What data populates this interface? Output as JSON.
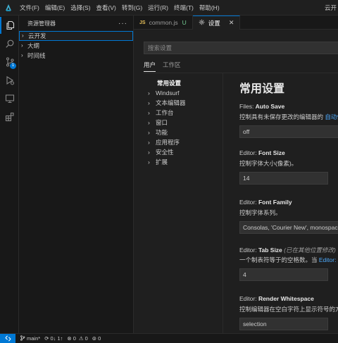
{
  "menubar": {
    "items": [
      "文件(F)",
      "编辑(E)",
      "选择(S)",
      "查看(V)",
      "转到(G)",
      "运行(R)",
      "终端(T)",
      "帮助(H)"
    ],
    "title_fragment": "云开"
  },
  "activitybar": {
    "icons": [
      "explorer-icon",
      "search-icon",
      "source-control-icon",
      "run-debug-icon",
      "remote-explorer-icon",
      "extensions-icon"
    ],
    "scm_badge": "1"
  },
  "explorer": {
    "title": "资源管理器",
    "more": "···",
    "items": [
      {
        "label": "云开发"
      },
      {
        "label": "大纲"
      },
      {
        "label": "时间线"
      }
    ]
  },
  "tabs": [
    {
      "icon": "JS",
      "label": "common.js",
      "status": "U"
    },
    {
      "icon": "gear-icon",
      "label": "设置",
      "close": "✕"
    }
  ],
  "settings": {
    "search_placeholder": "搜索设置",
    "scope_tabs": [
      "用户",
      "工作区"
    ],
    "toc": [
      {
        "label": "常用设置",
        "active": true
      },
      {
        "label": "Windsurf"
      },
      {
        "label": "文本编辑器"
      },
      {
        "label": "工作台"
      },
      {
        "label": "窗口"
      },
      {
        "label": "功能"
      },
      {
        "label": "应用程序"
      },
      {
        "label": "安全性"
      },
      {
        "label": "扩展"
      }
    ],
    "section_title": "常用设置",
    "items": [
      {
        "category": "Files: ",
        "name": "Auto Save",
        "desc": "控制具有未保存更改的编辑器的 ",
        "desc_link": "自动保",
        "value": "off"
      },
      {
        "category": "Editor: ",
        "name": "Font Size",
        "desc": "控制字体大小(像素)。",
        "value": "14"
      },
      {
        "category": "Editor: ",
        "name": "Font Family",
        "desc": "控制字体系列。",
        "value": "Consolas, 'Courier New', monospace"
      },
      {
        "category": "Editor: ",
        "name": "Tab Size",
        "note": "(已在其他位置修改)",
        "desc": "一个制表符等于的空格数。当 ",
        "desc_link": "Editor: D",
        "value": "4"
      },
      {
        "category": "Editor: ",
        "name": "Render Whitespace",
        "desc": "控制编辑器在空白字符上显示符号的方",
        "value": "selection"
      }
    ]
  },
  "statusbar": {
    "remote_icon": "remote-icon",
    "branch": "main*",
    "sync": "0↓ 1↑",
    "errors": "0",
    "warnings": "0",
    "ports": "0"
  },
  "colors": {
    "accent": "#0078d4",
    "link": "#4daafc",
    "js_icon": "#e8c15a",
    "untracked": "#73c991"
  }
}
